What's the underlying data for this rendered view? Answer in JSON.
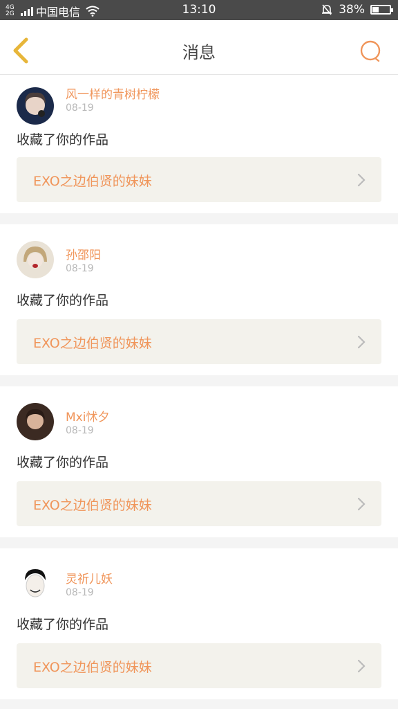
{
  "statusbar": {
    "network": "4G 2G",
    "carrier": "中国电信",
    "time": "13:10",
    "battery_text": "38%",
    "battery_level": 0.38
  },
  "header": {
    "title": "消息",
    "back_icon": "chevron-left-icon",
    "search_icon": "search-icon"
  },
  "messages": [
    {
      "user": "风一样的青树柠檬",
      "date": "08-19",
      "action": "收藏了你的作品",
      "work": "EXO之边伯贤的妹妹"
    },
    {
      "user": "孙邵阳",
      "date": "08-19",
      "action": "收藏了你的作品",
      "work": "EXO之边伯贤的妹妹"
    },
    {
      "user": "Mxi怵夕",
      "date": "08-19",
      "action": "收藏了你的作品",
      "work": "EXO之边伯贤的妹妹"
    },
    {
      "user": "灵祈儿妖",
      "date": "08-19",
      "action": "收藏了你的作品",
      "work": "EXO之边伯贤的妹妹"
    }
  ],
  "colors": {
    "accent": "#f0955a",
    "back_arrow": "#e7b63a",
    "statusbar": "#4a4a4a",
    "work_bg": "#f3f2ec"
  }
}
